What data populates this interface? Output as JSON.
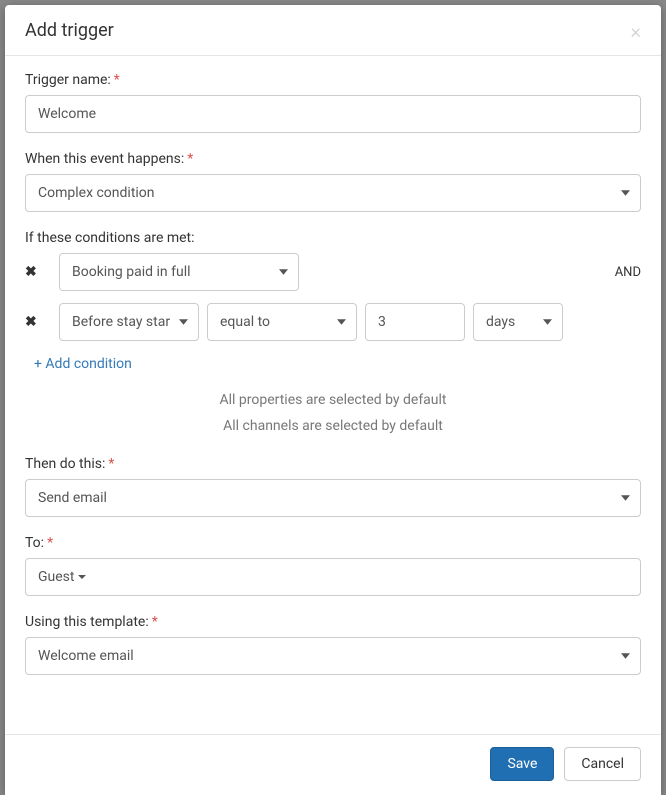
{
  "modal": {
    "title": "Add trigger"
  },
  "form": {
    "name_label": "Trigger name:",
    "name_value": "Welcome",
    "event_label": "When this event happens:",
    "event_value": "Complex condition",
    "conditions_label": "If these conditions are met:",
    "conditions": [
      {
        "field": "Booking paid in full",
        "and": "AND"
      },
      {
        "when": "Before stay starts",
        "operator": "equal to",
        "number": "3",
        "unit": "days"
      }
    ],
    "add_condition": "+ Add condition",
    "info_properties": "All properties are selected by default",
    "info_channels": "All channels are selected by default",
    "action_label": "Then do this:",
    "action_value": "Send email",
    "to_label": "To:",
    "to_value": "Guest",
    "template_label": "Using this template:",
    "template_value": "Welcome email"
  },
  "footer": {
    "save": "Save",
    "cancel": "Cancel"
  }
}
